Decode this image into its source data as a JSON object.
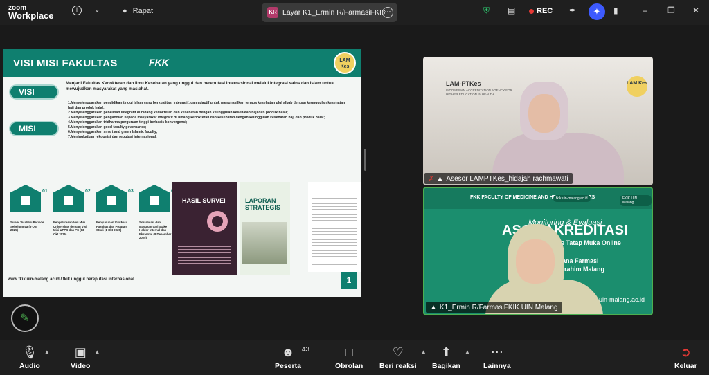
{
  "app": {
    "brand_line1": "zoom",
    "brand_line2": "Workplace",
    "meeting_tab": "Rapat"
  },
  "share_tab": {
    "initials": "KR",
    "title": "Layar K1_Ermin R/FarmasiFKIK UIN Malang"
  },
  "topbar": {
    "rec_label": "REC"
  },
  "slide": {
    "title": "VISI MISI FAKULTAS",
    "fkk": "FKK",
    "lam": "LAM\nKes",
    "visi_label": "VISI",
    "misi_label": "MISI",
    "visi_text": "Menjadi Fakultas Kedokteran dan Ilmu Kesehatan yang unggul dan bereputasi internasional melalui integrasi sains dan Islam untuk mewujudkan masyarakat yang maslahat.",
    "misi": [
      "1.Menyelenggarakan pendidikan tinggi Islam yang berkualitas, integratif, dan adaptif untuk menghasilkan tenaga kesehatan ulul albab dengan keunggulan kesehatan haji dan produk halal;",
      "2.Menyelenggarakan penelitian integratif di bidang kedokteran dan kesehatan dengan keunggulan kesehatan haji dan produk halal;",
      "3.Menyelenggarakan pengabdian kepada masyarakat integratif di bidang kedokteran dan kesehatan dengan keunggulan kesehatan haji dan produk halal;",
      "4.Menyelenggarakan tridharma perguruan tinggi berbasis konvergensi;",
      "5.Menyelenggarakan good faculty governance;",
      "6.Menyelenggarakan smart and green Islamic faculty;",
      "7.Meningkatkan rekognisi dan reputasi internasional."
    ],
    "steps": [
      {
        "num": "01",
        "caption": "Survei Visi Misi Periode Sebelumnya (9 Okt 2025)"
      },
      {
        "num": "02",
        "caption": "Penyelarasan Visi Misi Universitas dengan Visi Misi UPPS dan PS (13 Okt 2025)"
      },
      {
        "num": "03",
        "caption": "Penyusunan Visi Misi Fakultas dan Program Studi (1 Okt 2025)"
      },
      {
        "num": "04",
        "caption": "Sosialisasi dan Masukan dari Stake Holder Internal dan Eksternal (8 Desember 2025)"
      }
    ],
    "poster1_title": "HASIL SURVEI",
    "poster2_title": "LAPORAN STRATEGIS",
    "footer_url": "www.fkik.uin-malang.ac.id / fkik unggul bereputasi internasional",
    "page": "1"
  },
  "tiles": [
    {
      "sign_main": "LAM-PTKes",
      "sign_sub": "INDONESIAN ACCREDITATION AGENCY FOR HIGHER EDUCATION IN HEALTH",
      "logo": "LAM\nKes",
      "name": "Asesor LAMPTKes_hidajah rachmawati"
    },
    {
      "banner": "FKK  FACULTY OF MEDICINE AND HEALTH SCIENCES",
      "pill_a": "fkik.uin-malang.ac.id",
      "pill_b": "FKIK UIN Malang",
      "line1": "Monitoring & Evaluasi",
      "line2": "ASCA AKREDITASI",
      "line3": "PTKes Metode Tatap Muka Online",
      "line4": "ram Studi Sarjana Farmasi",
      "line5": "aulana Malik Ibrahim Malang",
      "url": "uin-malang.ac.id",
      "name": "K1_Ermin R/FarmasiFKIK UIN Malang"
    }
  ],
  "controls": {
    "audio": "Audio",
    "video": "Video",
    "participants": "Peserta",
    "participants_count": "43",
    "chat": "Obrolan",
    "react": "Beri reaksi",
    "share": "Bagikan",
    "more": "Lainnya",
    "leave": "Keluar"
  },
  "colors": {
    "accent": "#0f7f6f",
    "rec": "#e53935",
    "active_border": "#4caf50"
  }
}
